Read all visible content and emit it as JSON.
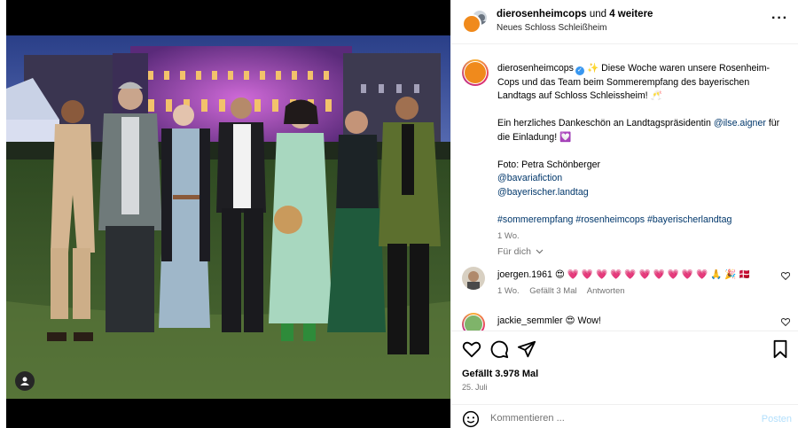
{
  "header": {
    "username": "dierosenheimcops",
    "collab_text": "und",
    "collab_count": "4 weitere",
    "location": "Neues Schloss Schleißheim"
  },
  "caption": {
    "username": "dierosenheimcops",
    "line1": "✨ Diese Woche waren unsere Rosenheim-Cops und das Team beim Sommerempfang des bayerischen Landtags auf Schloss Schleissheim! 🥂",
    "line2_pre": "Ein herzliches Dankeschön an Landtagspräsidentin",
    "line2_mention": "@ilse.aigner",
    "line2_post": "für die Einladung! 💟",
    "photo_credit": "Foto: Petra Schönberger",
    "mention1": "@bavariafiction",
    "mention2": "@bayerischer.landtag",
    "hashtags": "#sommerempfang #rosenheimcops #bayerischerlandtag",
    "time": "1 Wo."
  },
  "for_you": "Für dich",
  "comments": [
    {
      "username": "joergen.1961",
      "text": "😍 💗 💗 💗 💗 💗 💗 💗 💗 💗 💗 🙏 🎉 🇩🇰",
      "time": "1 Wo.",
      "likes": "Gefällt 3 Mal",
      "reply": "Antworten"
    },
    {
      "username": "jackie_semmler",
      "text": "😍 Wow!"
    }
  ],
  "likes_text": "Gefällt 3.978 Mal",
  "date": "25. Juli",
  "comment_placeholder": "Kommentieren ...",
  "post_label": "Posten",
  "colors": {
    "link": "#00376b",
    "brand_orange": "#f08a1c",
    "post_disabled": "#b2dffc"
  }
}
